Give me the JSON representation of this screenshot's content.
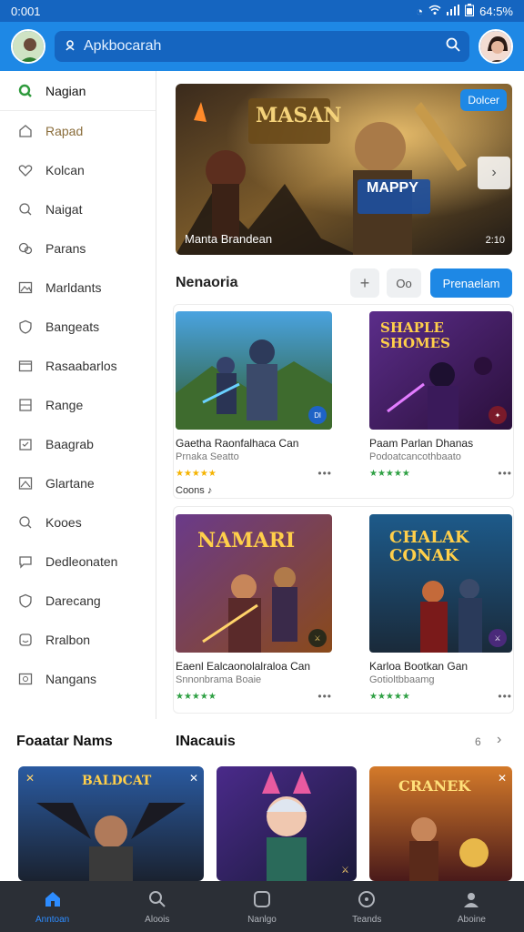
{
  "status": {
    "time": "0:001",
    "battery": "64:5%"
  },
  "header": {
    "search_placeholder": "Apkbocarah"
  },
  "sidebar": {
    "items": [
      {
        "label": "Nagian",
        "icon": "search-icon"
      },
      {
        "label": "Rapad",
        "icon": "home-icon"
      },
      {
        "label": "Kolcan",
        "icon": "heart-icon"
      },
      {
        "label": "Naigat",
        "icon": "search-icon"
      },
      {
        "label": "Parans",
        "icon": "chat-icon"
      },
      {
        "label": "Marldants",
        "icon": "image-icon"
      },
      {
        "label": "Bangeats",
        "icon": "shield-icon"
      },
      {
        "label": "Rasaabarlos",
        "icon": "folder-icon"
      },
      {
        "label": "Range",
        "icon": "grid-icon"
      },
      {
        "label": "Baagrab",
        "icon": "calendar-icon"
      },
      {
        "label": "Glartane",
        "icon": "picture-icon"
      },
      {
        "label": "Kooes",
        "icon": "search-icon"
      },
      {
        "label": "Dedleonaten",
        "icon": "chat-icon"
      },
      {
        "label": "Darecang",
        "icon": "shield-icon"
      },
      {
        "label": "Rralbon",
        "icon": "smile-icon"
      },
      {
        "label": "Nangans",
        "icon": "image-icon"
      }
    ]
  },
  "hero": {
    "badge": "Dolcer",
    "caption": "Manta Brandean",
    "time": "2:10",
    "logo_text": "MASAN",
    "sub_logo": "MAPPY"
  },
  "section": {
    "title": "Nenaoria",
    "plus_label": "+",
    "toggle_label": "Oo",
    "primary_label": "Prenaelam"
  },
  "cards": [
    {
      "title": "Gaetha Raonfalhaca Can",
      "sub": "Prnaka Seatto",
      "extra": "Coons  ♪",
      "logo": "",
      "badge": "Dl"
    },
    {
      "title": "Paam Parlan Dhanas",
      "sub": "Podoatcancothbaato",
      "extra": "",
      "logo": "SHAPLE SHOMES",
      "badge": "✦"
    },
    {
      "title": "Eaenl Ealcaonolalraloa Can",
      "sub": "Snnonbrama Boaie",
      "extra": "",
      "logo": "NAMARI",
      "badge": "⚔"
    },
    {
      "title": "Karloa Bootkan Gan",
      "sub": "Gotioltbbaamg",
      "extra": "",
      "logo": "CHALAK CONAK",
      "badge": "⚔"
    }
  ],
  "bottom": {
    "left_title": "Foaatar Nams",
    "mid_title": "INacauis",
    "count": "6",
    "cards": [
      {
        "logo": "BALDCAT"
      },
      {
        "logo": ""
      },
      {
        "logo": "CRANEK"
      }
    ]
  },
  "tabs": [
    {
      "label": "Anntoan",
      "icon": "home-icon"
    },
    {
      "label": "Aloois",
      "icon": "search-icon"
    },
    {
      "label": "Nanlgo",
      "icon": "square-icon"
    },
    {
      "label": "Teands",
      "icon": "circle-icon"
    },
    {
      "label": "Aboine",
      "icon": "user-icon"
    }
  ],
  "colors": {
    "primary": "#1e88e5",
    "header": "#1565c0",
    "tabbar": "#2b2f36",
    "star_yellow": "#f5b300",
    "star_green": "#2ea043"
  }
}
